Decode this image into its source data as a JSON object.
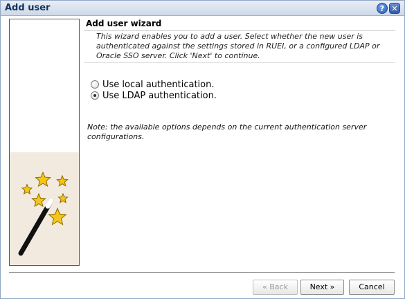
{
  "window": {
    "title": "Add user",
    "help_icon": "help-icon",
    "help_glyph": "?",
    "close_icon": "close-icon",
    "close_glyph": "✕"
  },
  "side_panel": {
    "illustration": "magic-wand-with-stars",
    "colors": {
      "panel_bg": "#f2eadf",
      "star_fill": "#f5c518",
      "star_stroke": "#8a6a00",
      "wand": "#111111"
    }
  },
  "wizard": {
    "title": "Add user wizard",
    "intro": "This wizard enables you to add a user. Select whether the new user is authenticated against the settings stored in RUEI, or a configured LDAP or Oracle SSO server. Click 'Next' to continue.",
    "options": [
      {
        "label": "Use local authentication.",
        "selected": false
      },
      {
        "label": "Use LDAP authentication.",
        "selected": true
      }
    ],
    "note": "Note: the available options depends on the current authentication server configurations."
  },
  "buttons": {
    "back": "« Back",
    "next": "Next »",
    "cancel": "Cancel"
  }
}
